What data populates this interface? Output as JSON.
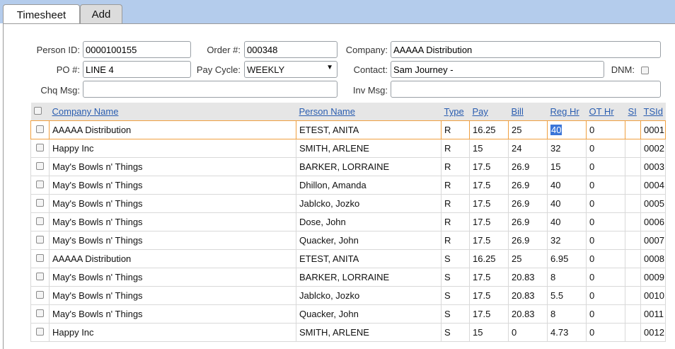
{
  "tabs": [
    {
      "label": "Timesheet",
      "active": true
    },
    {
      "label": "Add",
      "active": false
    }
  ],
  "form": {
    "person_id_label": "Person ID:",
    "person_id_value": "0000100155",
    "order_label": "Order #:",
    "order_value": "000348",
    "company_label": "Company:",
    "company_value": "AAAAA Distribution",
    "po_label": "PO #:",
    "po_value": "LINE 4",
    "pay_cycle_label": "Pay Cycle:",
    "pay_cycle_value": "WEEKLY",
    "contact_label": "Contact:",
    "contact_value": "Sam Journey -",
    "dnm_label": "DNM:",
    "chq_msg_label": "Chq Msg:",
    "chq_msg_value": "",
    "inv_msg_label": "Inv Msg:",
    "inv_msg_value": ""
  },
  "grid": {
    "columns": [
      "Company Name",
      "Person Name",
      "Type",
      "Pay",
      "Bill",
      "Reg Hr",
      "OT Hr",
      "SI",
      "TSId"
    ],
    "rows": [
      [
        "AAAAA Distribution",
        "ETEST, ANITA",
        "R",
        "16.25",
        "25",
        "40",
        "0",
        "",
        "0001"
      ],
      [
        "Happy Inc",
        "SMITH, ARLENE",
        "R",
        "15",
        "24",
        "32",
        "0",
        "",
        "0002"
      ],
      [
        "May's Bowls n' Things",
        "BARKER, LORRAINE",
        "R",
        "17.5",
        "26.9",
        "15",
        "0",
        "",
        "0003"
      ],
      [
        "May's Bowls n' Things",
        "Dhillon, Amanda",
        "R",
        "17.5",
        "26.9",
        "40",
        "0",
        "",
        "0004"
      ],
      [
        "May's Bowls n' Things",
        "Jablcko, Jozko",
        "R",
        "17.5",
        "26.9",
        "40",
        "0",
        "",
        "0005"
      ],
      [
        "May's Bowls n' Things",
        "Dose, John",
        "R",
        "17.5",
        "26.9",
        "40",
        "0",
        "",
        "0006"
      ],
      [
        "May's Bowls n' Things",
        "Quacker, John",
        "R",
        "17.5",
        "26.9",
        "32",
        "0",
        "",
        "0007"
      ],
      [
        "AAAAA Distribution",
        "ETEST, ANITA",
        "S",
        "16.25",
        "25",
        "6.95",
        "0",
        "",
        "0008"
      ],
      [
        "May's Bowls n' Things",
        "BARKER, LORRAINE",
        "S",
        "17.5",
        "20.83",
        "8",
        "0",
        "",
        "0009"
      ],
      [
        "May's Bowls n' Things",
        "Jablcko, Jozko",
        "S",
        "17.5",
        "20.83",
        "5.5",
        "0",
        "",
        "0010"
      ],
      [
        "May's Bowls n' Things",
        "Quacker, John",
        "S",
        "17.5",
        "20.83",
        "8",
        "0",
        "",
        "0011"
      ],
      [
        "Happy Inc",
        "SMITH, ARLENE",
        "S",
        "15",
        "0",
        "4.73",
        "0",
        "",
        "0012"
      ]
    ]
  }
}
